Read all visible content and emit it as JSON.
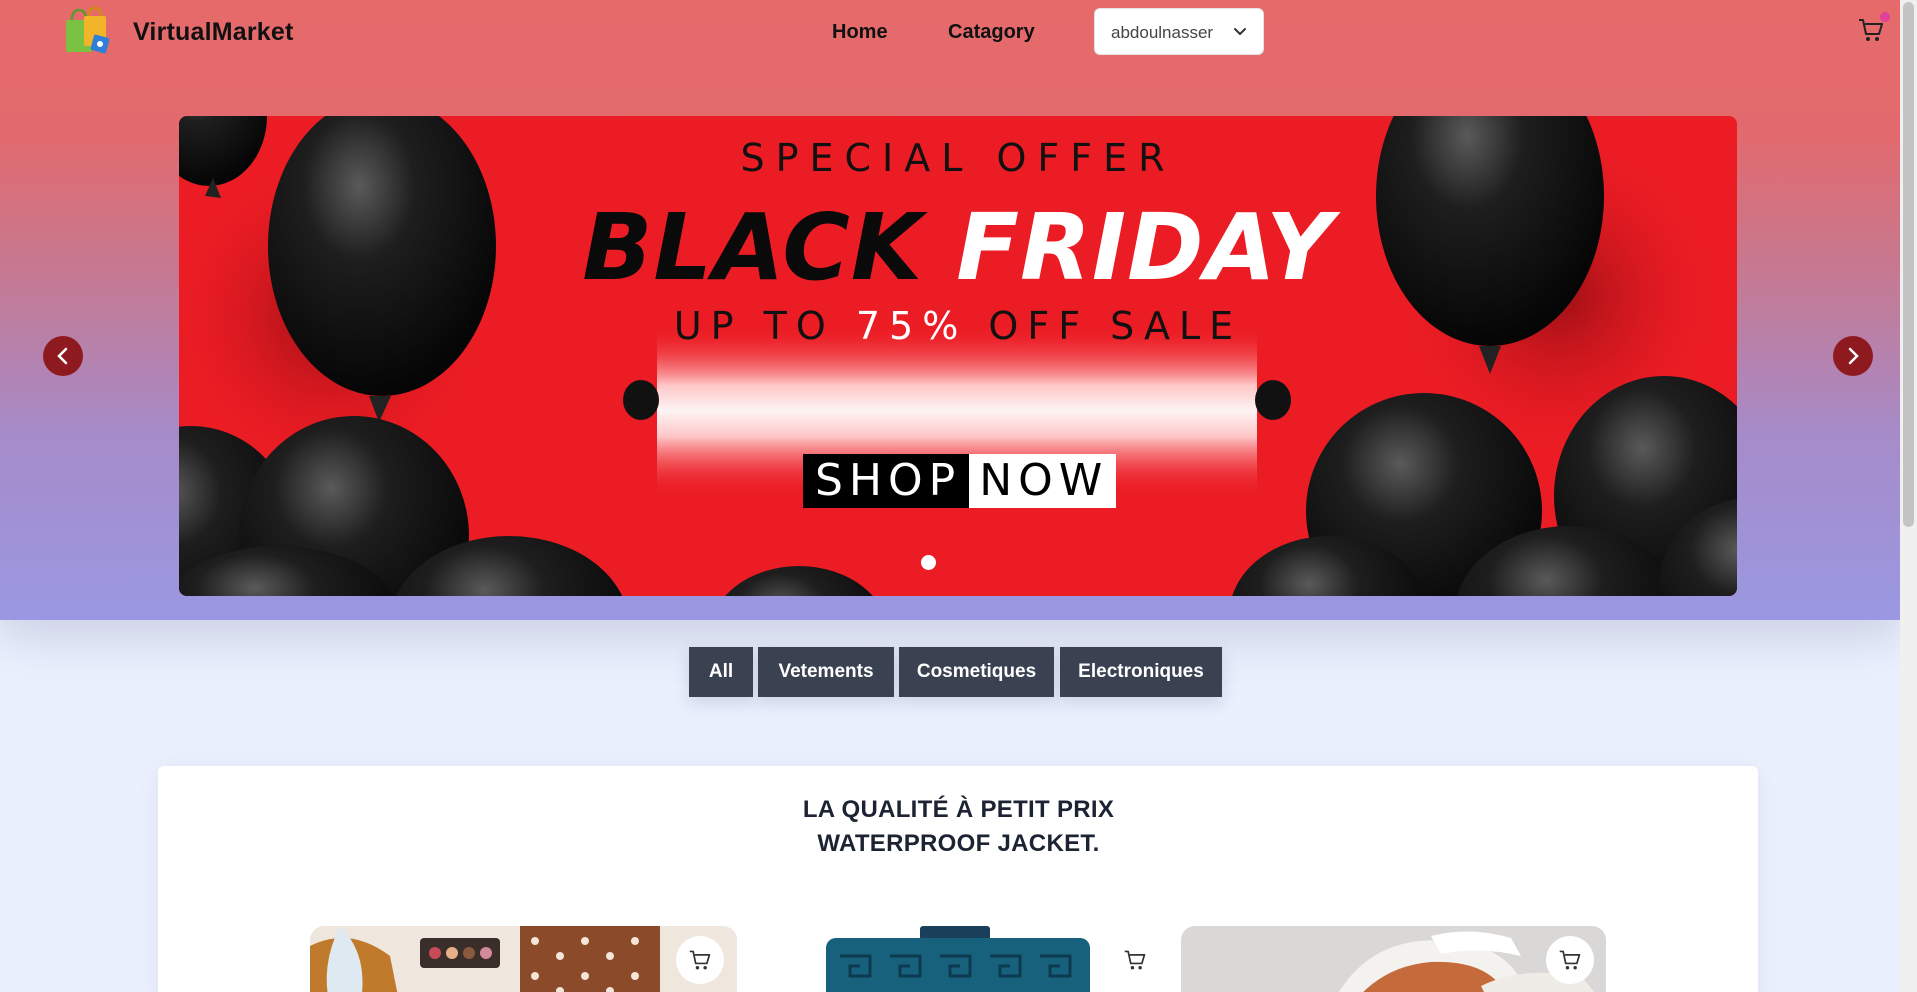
{
  "header": {
    "brand": "VirtualMarket",
    "nav": [
      {
        "label": "Home"
      },
      {
        "label": "Catagory"
      }
    ],
    "user_select": {
      "value": "abdoulnasser"
    },
    "icons": {
      "logo": "shopping-bags-logo",
      "cart": "cart-icon"
    }
  },
  "banner": {
    "line1": "SPECIAL OFFER",
    "line2_black": "BLACK",
    "line2_white": "FRIDAY",
    "line3_a": "UP TO ",
    "line3_pct": "75%",
    "line3_b": " OFF SALE",
    "cta_shop": "SHOP",
    "cta_now": "NOW",
    "colors": {
      "background": "#ec1c24",
      "balloons": "#111111"
    }
  },
  "categories": [
    {
      "label": "All"
    },
    {
      "label": "Vetements"
    },
    {
      "label": "Cosmetiques"
    },
    {
      "label": "Electroniques"
    }
  ],
  "products": {
    "title_line1": "LA QUALITÉ À PETIT PRIX",
    "title_line2": "WATERPROOF JACKET."
  }
}
